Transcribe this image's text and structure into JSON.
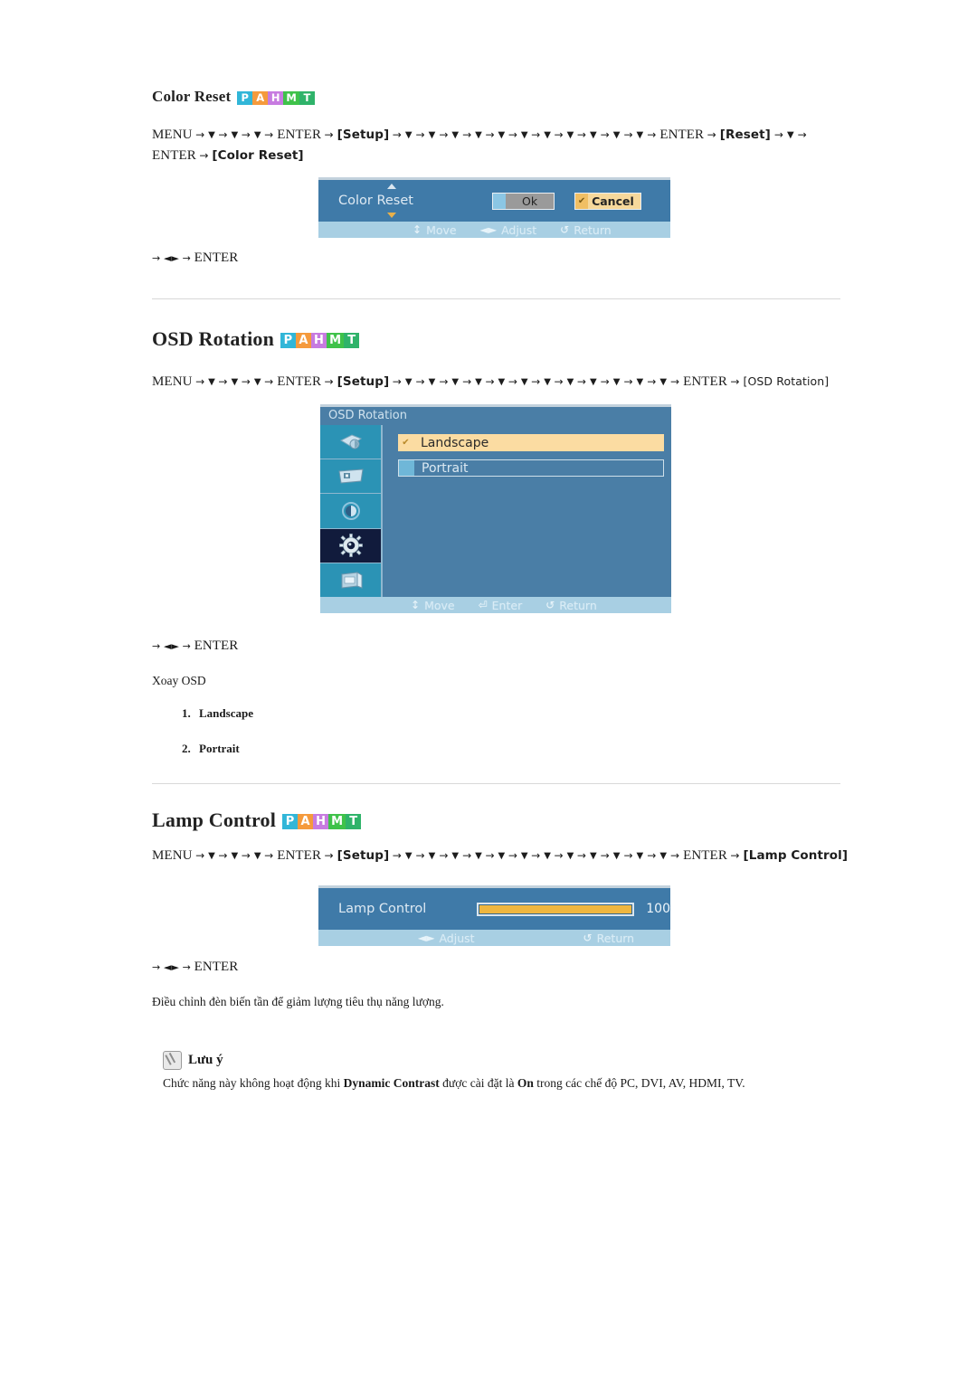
{
  "badge": {
    "letters": [
      {
        "ch": "P",
        "color": "#31b6d8"
      },
      {
        "ch": "A",
        "color": "#f59a3c"
      },
      {
        "ch": "H",
        "color": "#c77be0"
      },
      {
        "ch": "M",
        "color": "#3fc24a"
      },
      {
        "ch": "T",
        "color": "#2fb36a"
      }
    ]
  },
  "sections": [
    {
      "id": "color-reset",
      "title": "Color Reset",
      "path_html": "MENU → ▼ →▼ →▼ → ENTER → [Setup] → ▼→ ▼→ ▼→ ▼ → ▼ → ▼ → ▼ → ▼ →▼→ ▼→ ▼→ ENTER → [Reset]→ ▼→ ENTER → [Color Reset]",
      "keys": "→ ◄ ►→ ENTER"
    },
    {
      "id": "osd-rotation",
      "title": "OSD Rotation",
      "path_html": "MENU → ▼ →▼ →▼ → ENTER → [Setup] → ▼→ ▼→ ▼→ ▼ → ▼ → ▼ → ▼ → ▼ →▼→ ▼→ ▼→ ▼→ ENTER → [OSD Rotation]",
      "keys": "→ ◄ ►→ ENTER",
      "desc": "Xoay OSD",
      "options": [
        "Landscape",
        "Portrait"
      ]
    },
    {
      "id": "lamp-control",
      "title": "Lamp Control",
      "path_html": "MENU → ▼ →▼ →▼ → ENTER → [Setup] → ▼→ ▼→ ▼→ ▼ → ▼ → ▼ → ▼ → ▼ →▼→ ▼→ ▼→ ▼→ ENTER → [Lamp Control]",
      "keys": "→ ◄ ►→ ENTER",
      "desc": "Điều chỉnh đèn biến tần để giảm lượng tiêu thụ năng lượng."
    }
  ],
  "osd_color_reset": {
    "label": "Color Reset",
    "buttons": [
      {
        "name": "Ok",
        "style": "ok",
        "mark": ""
      },
      {
        "name": "Cancel",
        "style": "cancel",
        "mark": "✔"
      }
    ],
    "footer": [
      {
        "icon": "↕",
        "label": "Move"
      },
      {
        "icon": "◄►",
        "label": "Adjust"
      },
      {
        "icon": "↺",
        "label": "Return"
      }
    ]
  },
  "osd_rotation_menu": {
    "title": "OSD Rotation",
    "sidebar": [
      {
        "name": "picture-icon",
        "active": false
      },
      {
        "name": "screen-icon",
        "active": false
      },
      {
        "name": "sound-icon",
        "active": false
      },
      {
        "name": "setup-gear-icon",
        "active": true
      },
      {
        "name": "multi-control-icon",
        "active": false
      }
    ],
    "options": [
      {
        "label": "Landscape",
        "selected": true
      },
      {
        "label": "Portrait",
        "selected": false
      }
    ],
    "footer": [
      {
        "icon": "↕",
        "label": "Move"
      },
      {
        "icon": "⏎",
        "label": "Enter"
      },
      {
        "icon": "↺",
        "label": "Return"
      }
    ]
  },
  "osd_lamp_control": {
    "label": "Lamp Control",
    "value": "100",
    "fill_percent": 100,
    "footer": [
      {
        "icon": "◄►",
        "label": "Adjust"
      },
      {
        "icon": "↺",
        "label": "Return"
      }
    ]
  },
  "note": {
    "title": "Lưu ý",
    "text_before": "Chức năng này không hoạt động khi ",
    "bold_1": "Dynamic Contrast",
    "text_mid": " được cài đặt là ",
    "bold_2": "On",
    "text_after": " trong các chế độ PC, DVI, AV, HDMI, TV."
  }
}
